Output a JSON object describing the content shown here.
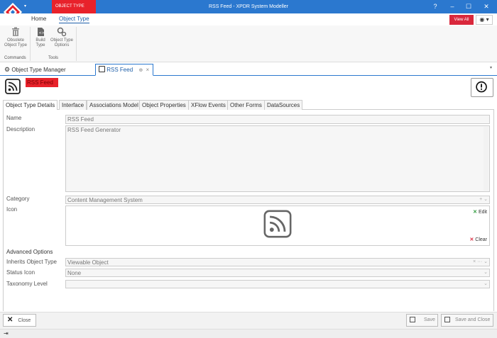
{
  "titlebar": {
    "context_badge": "OBJECT TYPE",
    "title": "RSS Feed - XPDR System Modeller",
    "help": "?",
    "minimize": "–",
    "maximize": "☐",
    "close": "✕",
    "quick_access": "▾"
  },
  "ribbon": {
    "tabs": [
      "Home",
      "Object Type"
    ],
    "view_all": "View All",
    "eye_menu": "◉ ▾",
    "buttons": {
      "obsolete_line1": "Obsolete",
      "obsolete_line2": "Object Type",
      "build_line1": "Build",
      "build_line2": "Type",
      "options_line1": "Object Type",
      "options_line2": "Options"
    },
    "groups": {
      "commands": "Commands",
      "tools": "Tools"
    }
  },
  "doc_tabs": {
    "manager": "Object Type Manager",
    "rss": "RSS Feed",
    "pin": "⊕",
    "close": "×",
    "overflow": "▾"
  },
  "header": {
    "object_name": "RSS Feed"
  },
  "inner_tabs": [
    "Object Type Details",
    "Interface",
    "Associations Model",
    "Object Properties",
    "XFlow Events",
    "Other Forms",
    "DataSources"
  ],
  "form": {
    "name_label": "Name",
    "name_value": "RSS Feed",
    "description_label": "Description",
    "description_value": "RSS Feed Generator",
    "category_label": "Category",
    "category_value": "Content Management System",
    "icon_label": "Icon",
    "edit_label": "Edit",
    "clear_label": "Clear",
    "advanced_title": "Advanced Options",
    "inherits_label": "Inherits Object Type",
    "inherits_value": "Viewable Object",
    "status_icon_label": "Status Icon",
    "status_icon_value": "None",
    "taxonomy_label": "Taxonomy Level",
    "taxonomy_value": ""
  },
  "bottom": {
    "close": "Close",
    "save": "Save",
    "save_close": "Save and Close"
  },
  "colors": {
    "title_blue": "#2b78cf",
    "accent_red": "#e8222b"
  }
}
